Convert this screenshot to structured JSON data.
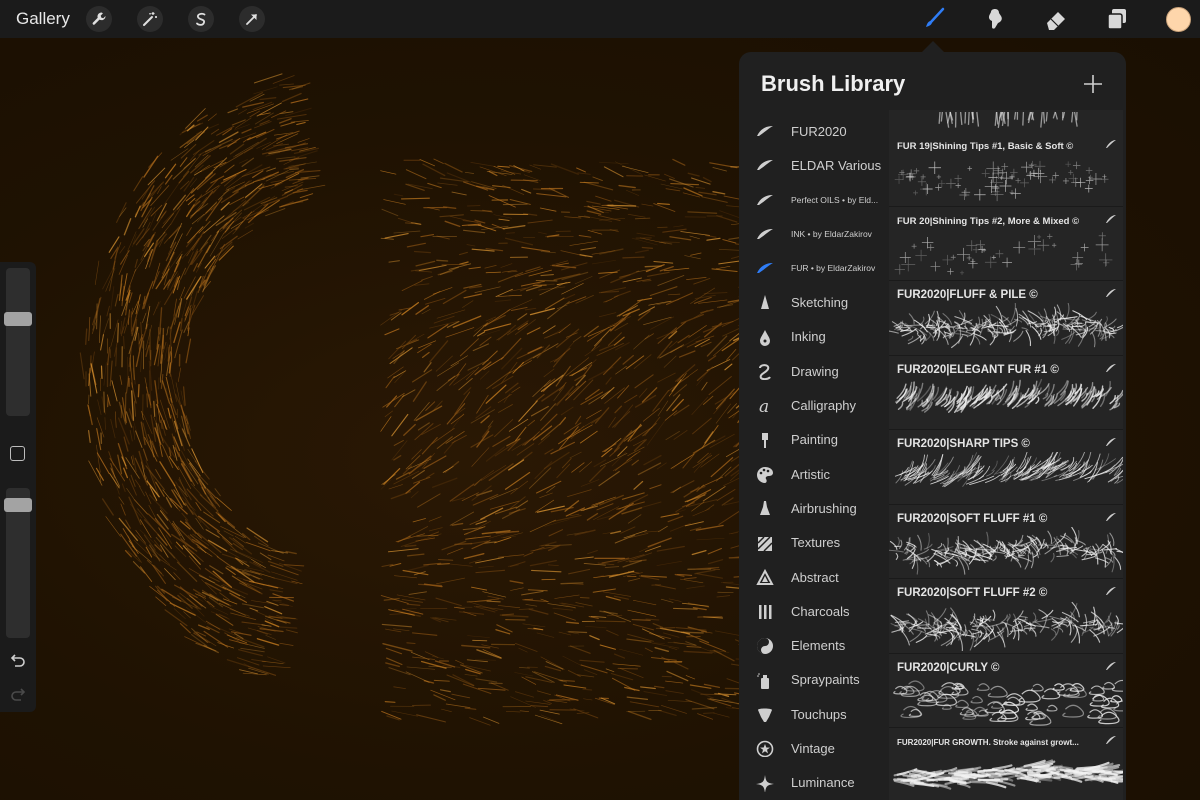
{
  "topbar": {
    "gallery_label": "Gallery",
    "left_tools": [
      "wrench-icon",
      "magic-wand-icon",
      "selection-icon",
      "transform-arrow-icon"
    ],
    "right_tools": [
      "brush-icon",
      "smudge-icon",
      "eraser-icon",
      "layers-icon"
    ],
    "active_tool": "brush-icon",
    "active_color": "#2f7df6",
    "current_color": "#fed6ab"
  },
  "sidebar": {
    "size_slider_level": 0.67,
    "opacity_slider_level": 0.93
  },
  "panel": {
    "title": "Brush Library",
    "categories": [
      {
        "label": "FUR2020",
        "icon": "feather-icon",
        "active": false
      },
      {
        "label": "ELDAR Various",
        "icon": "feather-icon",
        "active": false
      },
      {
        "label": "Perfect OILS • by Eld...",
        "icon": "feather-icon",
        "active": false
      },
      {
        "label": "INK • by EldarZakirov",
        "icon": "feather-icon",
        "active": false
      },
      {
        "label": "FUR • by EldarZakirov",
        "icon": "feather-icon",
        "active": true
      },
      {
        "label": "Sketching",
        "icon": "pencil-tip-icon",
        "active": false
      },
      {
        "label": "Inking",
        "icon": "ink-drop-icon",
        "active": false
      },
      {
        "label": "Drawing",
        "icon": "squiggle-icon",
        "active": false
      },
      {
        "label": "Calligraphy",
        "icon": "calligraphy-a-icon",
        "active": false
      },
      {
        "label": "Painting",
        "icon": "paintbrush-icon",
        "active": false
      },
      {
        "label": "Artistic",
        "icon": "palette-icon",
        "active": false
      },
      {
        "label": "Airbrushing",
        "icon": "airbrush-icon",
        "active": false
      },
      {
        "label": "Textures",
        "icon": "texture-icon",
        "active": false
      },
      {
        "label": "Abstract",
        "icon": "triangle-icon",
        "active": false
      },
      {
        "label": "Charcoals",
        "icon": "charcoal-icon",
        "active": false
      },
      {
        "label": "Elements",
        "icon": "yin-yang-icon",
        "active": false
      },
      {
        "label": "Spraypaints",
        "icon": "spraycan-icon",
        "active": false
      },
      {
        "label": "Touchups",
        "icon": "touchup-icon",
        "active": false
      },
      {
        "label": "Vintage",
        "icon": "star-circle-icon",
        "active": false
      },
      {
        "label": "Luminance",
        "icon": "sparkle-icon",
        "active": false
      }
    ],
    "brushes": [
      {
        "name": "FUR 19|Shining Tips #1, Basic & Soft ©",
        "style": "dots"
      },
      {
        "name": "FUR 20|Shining Tips #2, More & Mixed ©",
        "style": "sparse"
      },
      {
        "name": "FUR2020|FLUFF & PILE ©",
        "style": "fluff"
      },
      {
        "name": "FUR2020|ELEGANT FUR #1 ©",
        "style": "elegant"
      },
      {
        "name": "FUR2020|SHARP TIPS ©",
        "style": "sharp"
      },
      {
        "name": "FUR2020|SOFT FLUFF #1 ©",
        "style": "soft"
      },
      {
        "name": "FUR2020|SOFT FLUFF #2 ©",
        "style": "soft2"
      },
      {
        "name": "FUR2020|CURLY ©",
        "style": "curly"
      },
      {
        "name": "FUR2020|FUR GROWTH. Stroke against growt...",
        "style": "growth"
      }
    ]
  }
}
